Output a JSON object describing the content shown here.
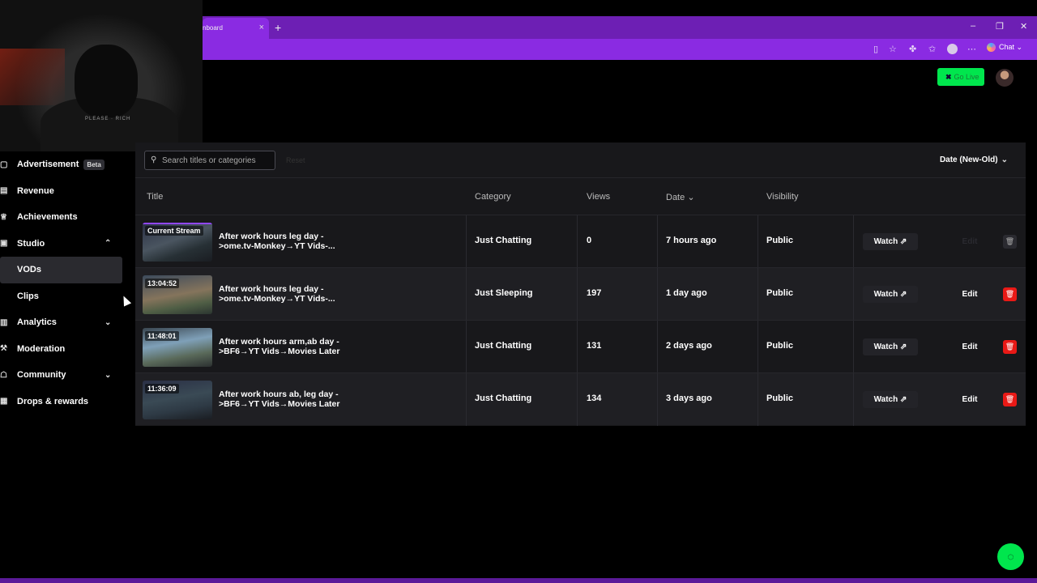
{
  "browser": {
    "tab_title": "nboard",
    "tab_close": "×",
    "new_tab": "+",
    "window_controls": [
      "–",
      "❐",
      "✕"
    ],
    "chat_label": "Chat"
  },
  "header": {
    "go_live_label": "Go Live"
  },
  "webcam": {
    "shirt_text": "PLEASE · RICH"
  },
  "sidebar": {
    "items": [
      {
        "label": "Advertisement",
        "badge": "Beta",
        "icon": "ad-icon"
      },
      {
        "label": "Revenue",
        "icon": "revenue-icon"
      },
      {
        "label": "Achievements",
        "icon": "trophy-icon"
      },
      {
        "label": "Studio",
        "icon": "studio-icon",
        "expanded": true
      },
      {
        "label": "VODs",
        "active": true
      },
      {
        "label": "Clips"
      },
      {
        "label": "Analytics",
        "icon": "analytics-icon",
        "expanded": false
      },
      {
        "label": "Moderation",
        "icon": "wrench-icon"
      },
      {
        "label": "Community",
        "icon": "community-icon",
        "expanded": false
      },
      {
        "label": "Drops & rewards",
        "icon": "drops-icon"
      }
    ]
  },
  "toolbar": {
    "search_placeholder": "Search titles or categories",
    "reset_label": "Reset",
    "sort_label": "Date (New-Old)"
  },
  "table": {
    "columns": {
      "title": "Title",
      "category": "Category",
      "views": "Views",
      "date": "Date",
      "visibility": "Visibility"
    },
    "watch_label": "Watch",
    "edit_label": "Edit",
    "rows": [
      {
        "thumb_label": "Current Stream",
        "title": "After work hours leg day - >ome.tv-Monkey→YT Vids-...",
        "category": "Just Chatting",
        "views": "0",
        "date": "7 hours ago",
        "visibility": "Public",
        "editable": false
      },
      {
        "thumb_label": "13:04:52",
        "title": "After work hours leg day - >ome.tv-Monkey→YT Vids-...",
        "category": "Just Sleeping",
        "views": "197",
        "date": "1 day ago",
        "visibility": "Public",
        "editable": true
      },
      {
        "thumb_label": "11:48:01",
        "title": "After work hours arm,ab day - >BF6→YT Vids→Movies Later",
        "category": "Just Chatting",
        "views": "131",
        "date": "2 days ago",
        "visibility": "Public",
        "editable": true
      },
      {
        "thumb_label": "11:36:09",
        "title": "After work hours ab, leg day - >BF6→YT Vids→Movies Later",
        "category": "Just Chatting",
        "views": "134",
        "date": "3 days ago",
        "visibility": "Public",
        "editable": true
      }
    ]
  },
  "colors": {
    "brand_purple": "#8a2be2",
    "go_live_green": "#00e64d",
    "delete_red": "#e91916"
  }
}
